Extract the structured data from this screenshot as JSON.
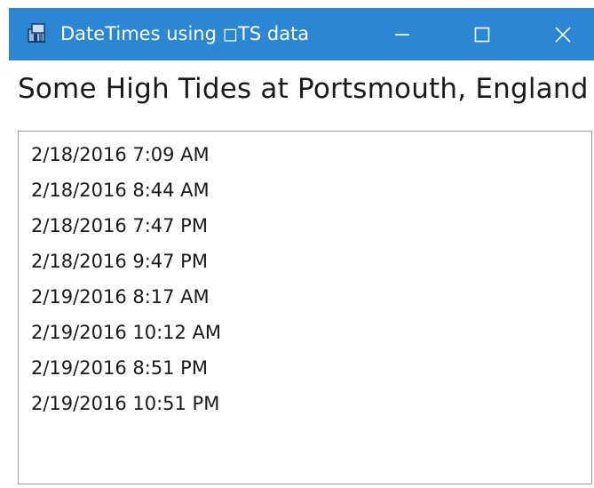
{
  "window": {
    "title": "DateTimes using ◻TS data",
    "controls": {
      "minimize_icon": "minimize-icon",
      "maximize_icon": "maximize-icon",
      "close_icon": "close-icon"
    },
    "titlebar_color": "#2b87d3"
  },
  "content": {
    "heading": "Some High Tides at Portsmouth, England",
    "list_items": [
      "2/18/2016 7:09 AM",
      "2/18/2016 8:44 AM",
      "2/18/2016 7:47 PM",
      "2/18/2016 9:47 PM",
      "2/19/2016 8:17 AM",
      "2/19/2016 10:12 AM",
      "2/19/2016 8:51 PM",
      "2/19/2016 10:51 PM"
    ]
  }
}
